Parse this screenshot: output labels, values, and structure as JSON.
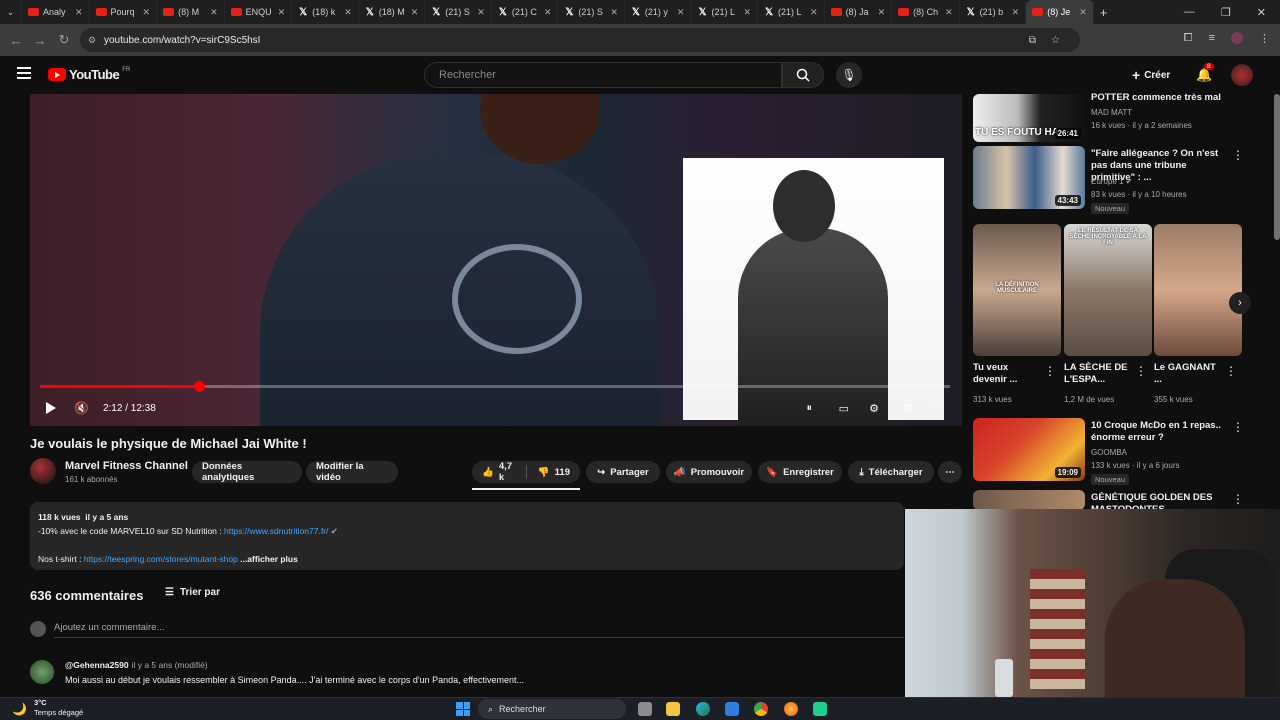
{
  "browser": {
    "tabs": [
      {
        "label": "Analy",
        "icon": "youtube"
      },
      {
        "label": "Pourq",
        "icon": "youtube"
      },
      {
        "label": "(8) M",
        "icon": "youtube"
      },
      {
        "label": "ENQU",
        "icon": "youtube"
      },
      {
        "label": "(18) k",
        "icon": "x"
      },
      {
        "label": "(18) M",
        "icon": "x"
      },
      {
        "label": "(21) S",
        "icon": "x"
      },
      {
        "label": "(21) C",
        "icon": "x"
      },
      {
        "label": "(21) S",
        "icon": "x"
      },
      {
        "label": "(21) y",
        "icon": "x"
      },
      {
        "label": "(21) L",
        "icon": "x"
      },
      {
        "label": "(21) L",
        "icon": "x"
      },
      {
        "label": "(8) Ja",
        "icon": "youtube"
      },
      {
        "label": "(8) Ch",
        "icon": "youtube"
      },
      {
        "label": "(21) b",
        "icon": "x"
      },
      {
        "label": "(8) Je",
        "icon": "youtube",
        "active": true
      }
    ],
    "url": "youtube.com/watch?v=sirC9Sc5hsI"
  },
  "youtube": {
    "logo_text": "YouTube",
    "region": "FR",
    "search_placeholder": "Rechercher",
    "create_label": "Créer",
    "notif_count": "8"
  },
  "player": {
    "time": "2:12 / 12:38",
    "progress": 0.175
  },
  "video": {
    "title": "Je voulais le physique de Michael Jai White !",
    "channel": "Marvel Fitness Channel",
    "subs": "161 k abonnés",
    "analytics_btn": "Données analytiques",
    "edit_btn": "Modifier la vidéo",
    "likes": "4,7 k",
    "dislikes": "119",
    "share": "Partager",
    "promote": "Promouvoir",
    "save": "Enregistrer",
    "download": "Télécharger"
  },
  "description": {
    "views": "118 k vues",
    "age": "il y a 5 ans",
    "line1": "-10% avec le code MARVEL10 sur SD Nutrition : ",
    "link1": "https://www.sdnutrition77.fr/",
    "line2": "Nos t-shirt : ",
    "link2": "https://teespring.com/stores/mutant-shop",
    "more": "...afficher plus"
  },
  "comments": {
    "count": "636 commentaires",
    "sort": "Trier par",
    "add_placeholder": "Ajoutez un commentaire...",
    "first": {
      "user": "@Gehenna2590",
      "time": "il y a 5 ans (modifié)",
      "text": "Moi aussi au début je voulais ressembler à Simeon Panda.... J'ai terminé avec le corps d'un Panda, effectivement..."
    }
  },
  "sidebar": {
    "v1": {
      "title": "POTTER commence très mal",
      "channel": "MAD MATT",
      "meta": "16 k vues · il y a 2 semaines",
      "duration": "26:41",
      "thumb_text": "TU ES FOUTU HA"
    },
    "v2": {
      "title": "\"Faire allégeance ? On n'est pas dans une tribune primitive\" : ...",
      "channel": "Europe 1",
      "meta": "83 k vues · il y a 10 heures",
      "duration": "43:43",
      "badge": "Nouveau"
    },
    "shorts": [
      {
        "title": "Tu veux devenir ...",
        "views": "313 k vues",
        "thumb_text": "LA DÉFINITION MUSCULAIRE"
      },
      {
        "title": "LA SÈCHE DE L'ESPA...",
        "views": "1,2 M de vues",
        "thumb_text": "LE RÉSULTAT DE SA SÈCHE INCROYABLE À LA FIN"
      },
      {
        "title": "Le GAGNANT ...",
        "views": "355 k vues",
        "thumb_text": ""
      }
    ],
    "v3": {
      "title": "10 Croque McDo en 1 repas.. énorme erreur ?",
      "channel": "GOOMBA",
      "meta": "133 k vues · il y a 6 jours",
      "duration": "19:09",
      "badge": "Nouveau"
    },
    "v4": {
      "title": "GÉNÉTIQUE GOLDEN DES MASTODONTES..."
    }
  },
  "taskbar": {
    "temp": "3°C",
    "weather": "Temps dégagé",
    "search": "Rechercher"
  },
  "colors": {
    "accent": "#ff0000",
    "link": "#3ea6ff",
    "bg": "#0f0f0f"
  }
}
